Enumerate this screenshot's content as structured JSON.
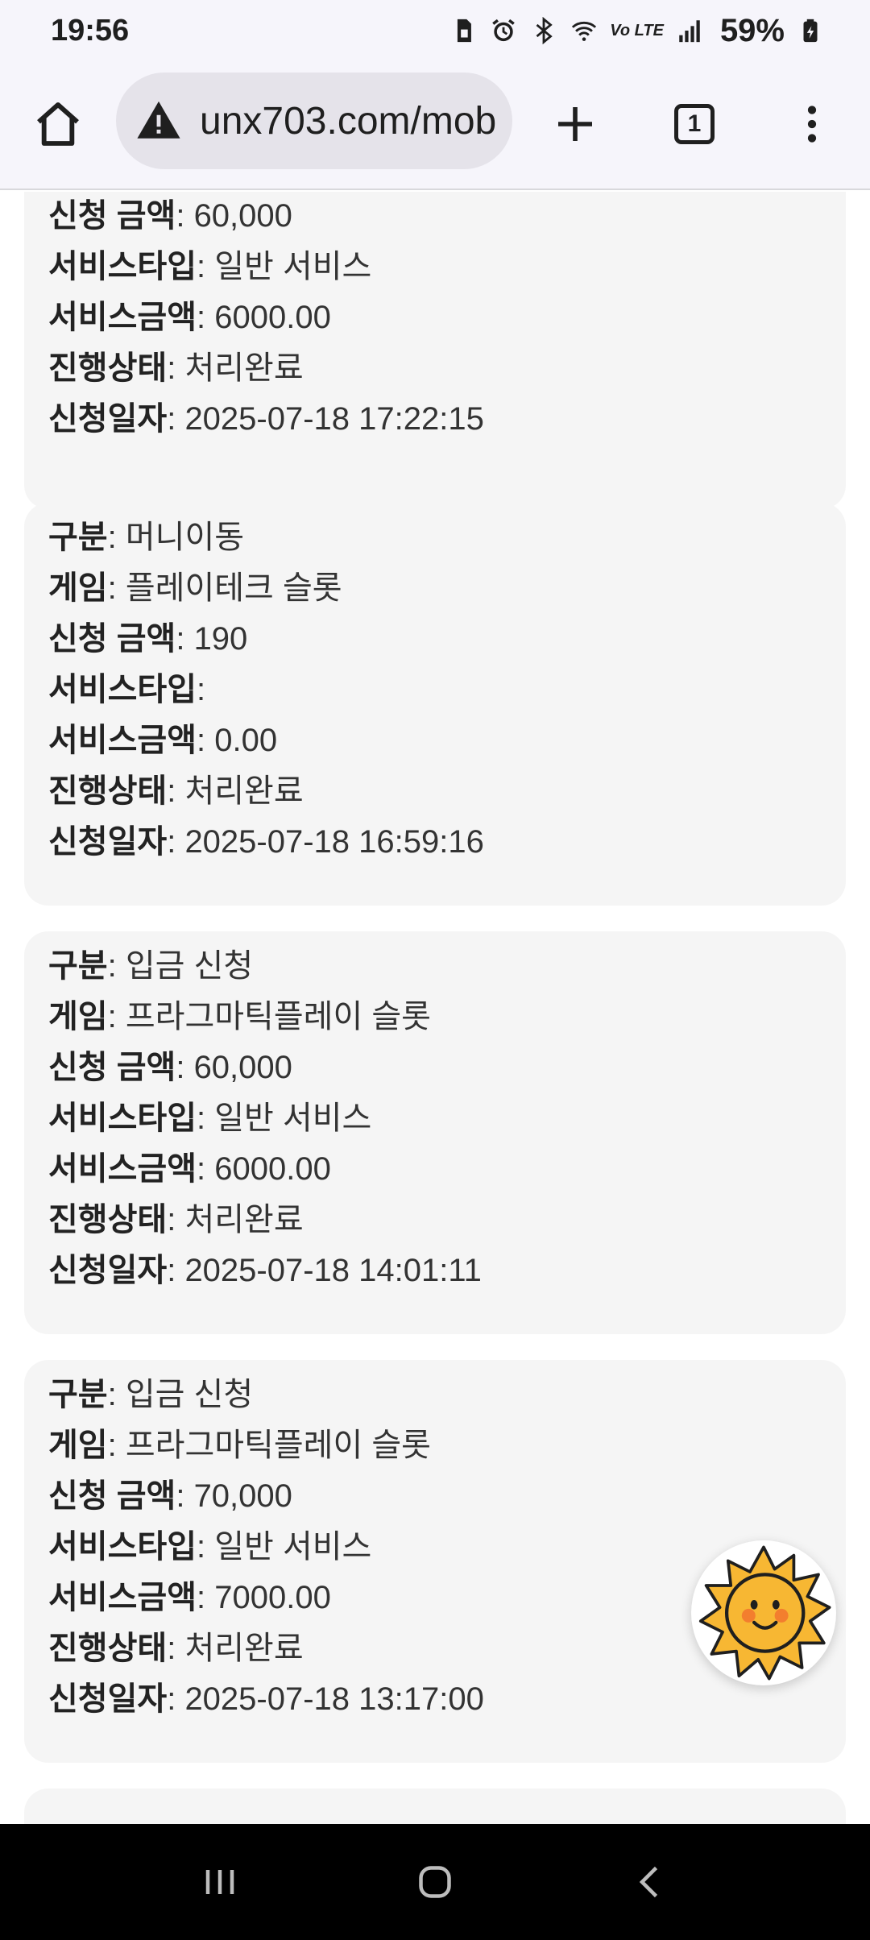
{
  "status_bar": {
    "time": "19:56",
    "network_label": "Vo LTE",
    "battery": "59%",
    "icons": [
      "sim-icon",
      "alarm-icon",
      "bluetooth-icon",
      "wifi-icon",
      "signal-icon",
      "battery-icon"
    ]
  },
  "browser": {
    "url": "unx703.com/mob",
    "tab_count": "1",
    "icons": [
      "home-icon",
      "warning-icon",
      "plus-icon",
      "tabs-icon",
      "more-vert-icon"
    ]
  },
  "labels": {
    "type": "구분",
    "game": "게임",
    "amount": "신청 금액",
    "service_type": "서비스타입",
    "service_amount": "서비스금액",
    "status": "진행상태",
    "date": "신청일자",
    "sep": ": "
  },
  "records": [
    {
      "amount": "60,000",
      "service_type": "일반 서비스",
      "service_amount": "6000.00",
      "status": "처리완료",
      "date": "2025-07-18 17:22:15"
    },
    {
      "type": "머니이동",
      "game": "플레이테크 슬롯",
      "amount": "190",
      "service_type": "",
      "service_amount": "0.00",
      "status": "처리완료",
      "date": "2025-07-18 16:59:16"
    },
    {
      "type": "입금 신청",
      "game": "프라그마틱플레이 슬롯",
      "amount": "60,000",
      "service_type": "일반 서비스",
      "service_amount": "6000.00",
      "status": "처리완료",
      "date": "2025-07-18 14:01:11"
    },
    {
      "type": "입금 신청",
      "game": "프라그마틱플레이 슬롯",
      "amount": "70,000",
      "service_type": "일반 서비스",
      "service_amount": "7000.00",
      "status": "처리완료",
      "date": "2025-07-18 13:17:00"
    }
  ],
  "fab": {
    "icon": "sun-face-icon"
  },
  "nav": {
    "icons": [
      "recent-apps-icon",
      "home-circle-icon",
      "back-icon"
    ]
  }
}
